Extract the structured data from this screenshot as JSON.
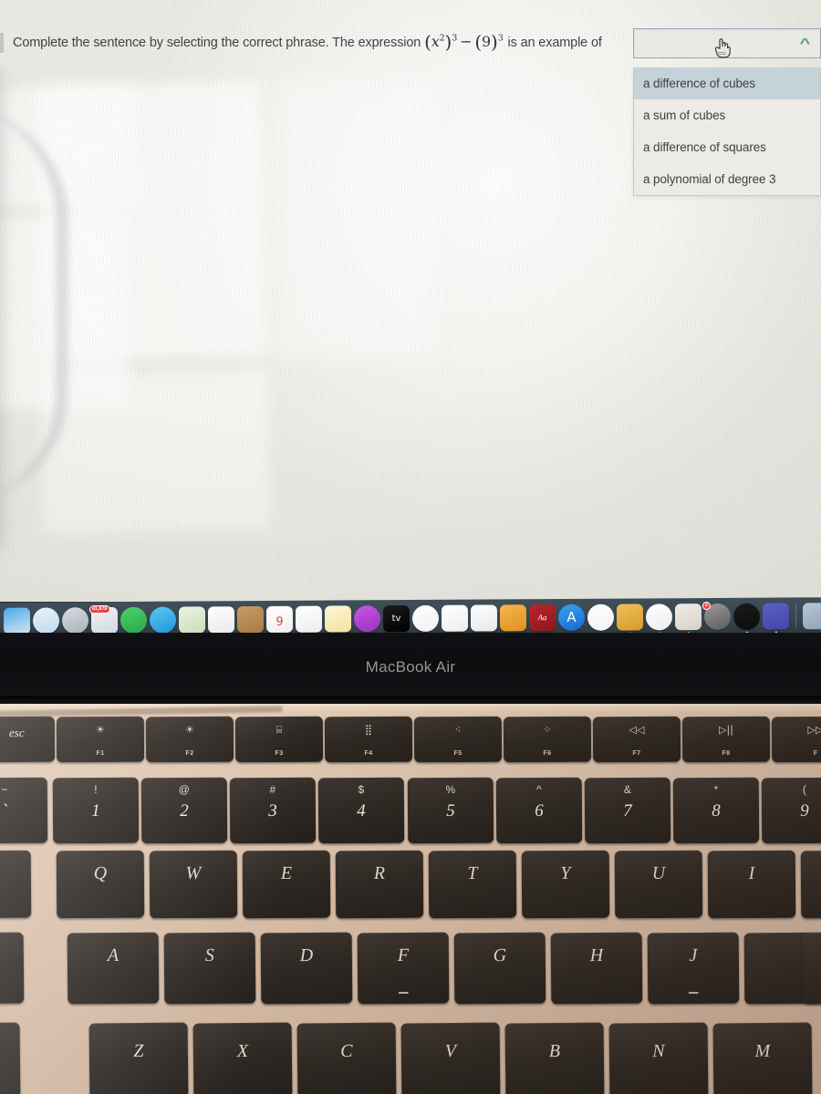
{
  "question": {
    "prefix": "Complete the sentence by selecting the correct phrase. The expression",
    "expr_base": "x",
    "expr_inner_exp": "2",
    "expr_outer_exp": "3",
    "expr_operator": "−",
    "expr_second_base": "9",
    "expr_second_exp": "3",
    "suffix": "is an example of"
  },
  "combo": {
    "value": "",
    "placeholder": "",
    "caret_glyph": "^",
    "caret_color": "#5d9e85",
    "border_color": "#9aa2bc"
  },
  "dropdown": {
    "highlight_color": "#c6d2d9",
    "options": [
      {
        "label": "a difference of cubes",
        "selected": true
      },
      {
        "label": "a sum of cubes",
        "selected": false
      },
      {
        "label": "a difference of squares",
        "selected": false
      },
      {
        "label": "a polynomial of degree 3",
        "selected": false
      }
    ]
  },
  "cursor": {
    "type": "pointing-hand-cursor"
  },
  "dock": {
    "items": [
      {
        "name": "finder",
        "color1": "#4aa8e8",
        "color2": "#d9e6ef",
        "glyph": "",
        "running": true,
        "badge": ""
      },
      {
        "name": "safari",
        "color1": "#e9f3fb",
        "color2": "#bcd9ef",
        "glyph": "",
        "running": false,
        "badge": ""
      },
      {
        "name": "launchpad",
        "color1": "#d8dde1",
        "color2": "#a8b0b6",
        "glyph": "",
        "running": false,
        "badge": ""
      },
      {
        "name": "photos",
        "color1": "#f3f3f3",
        "color2": "#cfd8e2",
        "glyph": "",
        "running": true,
        "badge": "41,878"
      },
      {
        "name": "facetime",
        "color1": "#4cd268",
        "color2": "#2aa84a",
        "glyph": "",
        "running": false,
        "badge": ""
      },
      {
        "name": "messages",
        "color1": "#5ac8f5",
        "color2": "#2196d8",
        "glyph": "",
        "running": false,
        "badge": ""
      },
      {
        "name": "maps",
        "color1": "#eef3e6",
        "color2": "#c9ddb5",
        "glyph": "",
        "running": false,
        "badge": ""
      },
      {
        "name": "photos-rainbow",
        "color1": "#ffffff",
        "color2": "#e9e9e9",
        "glyph": "",
        "running": false,
        "badge": ""
      },
      {
        "name": "contacts",
        "color1": "#c99b63",
        "color2": "#a87a45",
        "glyph": "",
        "running": false,
        "badge": ""
      },
      {
        "name": "calendar",
        "color1": "#ffffff",
        "color2": "#efefef",
        "glyph": "9",
        "running": true,
        "badge": ""
      },
      {
        "name": "reminders",
        "color1": "#ffffff",
        "color2": "#ededed",
        "glyph": "",
        "running": false,
        "badge": ""
      },
      {
        "name": "notes",
        "color1": "#fdf6d8",
        "color2": "#f3e39a",
        "glyph": "",
        "running": false,
        "badge": ""
      },
      {
        "name": "podcasts",
        "color1": "#c65ae0",
        "color2": "#9a2fc4",
        "glyph": "",
        "running": true,
        "badge": ""
      },
      {
        "name": "apple-tv",
        "color1": "#1b1b1b",
        "color2": "#000000",
        "glyph": "tv",
        "running": false,
        "badge": ""
      },
      {
        "name": "news",
        "color1": "#ffffff",
        "color2": "#f0f0f0",
        "glyph": "",
        "running": false,
        "badge": ""
      },
      {
        "name": "numbers",
        "color1": "#ffffff",
        "color2": "#eeeeee",
        "glyph": "",
        "running": true,
        "badge": ""
      },
      {
        "name": "keynote",
        "color1": "#ffffff",
        "color2": "#e7e7e7",
        "glyph": "",
        "running": true,
        "badge": ""
      },
      {
        "name": "pages",
        "color1": "#f7b64a",
        "color2": "#e08f22",
        "glyph": "",
        "running": true,
        "badge": ""
      },
      {
        "name": "dictionary",
        "color1": "#b9252a",
        "color2": "#8c171c",
        "glyph": "Aa",
        "running": false,
        "badge": ""
      },
      {
        "name": "app-store",
        "color1": "#3aa4f0",
        "color2": "#1766cf",
        "glyph": "A",
        "running": false,
        "badge": ""
      },
      {
        "name": "music",
        "color1": "#ffffff",
        "color2": "#f2f2f2",
        "glyph": "",
        "running": true,
        "badge": ""
      },
      {
        "name": "imovie",
        "color1": "#efc15b",
        "color2": "#d79a2a",
        "glyph": "",
        "running": true,
        "badge": ""
      },
      {
        "name": "chrome",
        "color1": "#ffffff",
        "color2": "#ececec",
        "glyph": "",
        "running": true,
        "badge": ""
      },
      {
        "name": "preview",
        "color1": "#f0ede8",
        "color2": "#d6d0c7",
        "glyph": "",
        "running": true,
        "badge": ""
      },
      {
        "name": "system-preferences",
        "color1": "#9a9a9a",
        "color2": "#5c5c5c",
        "glyph": "",
        "running": false,
        "badge": "2"
      },
      {
        "name": "webex",
        "color1": "#1d1d1d",
        "color2": "#0a0a0a",
        "glyph": "",
        "running": true,
        "badge": ""
      },
      {
        "name": "microsoft-teams",
        "color1": "#5b5fc7",
        "color2": "#4347a8",
        "glyph": "",
        "running": true,
        "badge": ""
      },
      {
        "name": "downloads-stack",
        "color1": "#b9c8d6",
        "color2": "#8ea2b4",
        "glyph": "",
        "running": false,
        "badge": ""
      }
    ]
  },
  "laptop": {
    "brand": "MacBook Air"
  },
  "keyboard": {
    "function_row": [
      {
        "key": "esc",
        "glyph": "",
        "sub": "",
        "icon": "escape-key"
      },
      {
        "key": "f1",
        "glyph": "☀",
        "sub": "F1",
        "icon": "brightness-down-icon"
      },
      {
        "key": "f2",
        "glyph": "☀",
        "sub": "F2",
        "icon": "brightness-up-icon"
      },
      {
        "key": "f3",
        "glyph": "⌸",
        "sub": "F3",
        "icon": "mission-control-icon"
      },
      {
        "key": "f4",
        "glyph": "⣿",
        "sub": "F4",
        "icon": "launchpad-icon"
      },
      {
        "key": "f5",
        "glyph": "⁖",
        "sub": "F5",
        "icon": "keyboard-backlight-down-icon"
      },
      {
        "key": "f6",
        "glyph": "⁘",
        "sub": "F6",
        "icon": "keyboard-backlight-up-icon"
      },
      {
        "key": "f7",
        "glyph": "◁◁",
        "sub": "F7",
        "icon": "rewind-icon"
      },
      {
        "key": "f8",
        "glyph": "▷||",
        "sub": "F8",
        "icon": "play-pause-icon"
      },
      {
        "key": "f9",
        "glyph": "▷▷",
        "sub": "F",
        "icon": "fast-forward-icon"
      }
    ],
    "number_row": [
      {
        "shift": "~",
        "digit": "`"
      },
      {
        "shift": "!",
        "digit": "1"
      },
      {
        "shift": "@",
        "digit": "2"
      },
      {
        "shift": "#",
        "digit": "3"
      },
      {
        "shift": "$",
        "digit": "4"
      },
      {
        "shift": "%",
        "digit": "5"
      },
      {
        "shift": "^",
        "digit": "6"
      },
      {
        "shift": "&",
        "digit": "7"
      },
      {
        "shift": "*",
        "digit": "8"
      },
      {
        "shift": "(",
        "digit": "9"
      }
    ],
    "qwerty_row": [
      "",
      "Q",
      "W",
      "E",
      "R",
      "T",
      "Y",
      "U",
      "I"
    ],
    "home_row": [
      "",
      "A",
      "S",
      "D",
      "F",
      "G",
      "H",
      "J",
      ""
    ],
    "bottom_row": [
      "",
      "Z",
      "X",
      "C",
      "V",
      "B",
      "N",
      "M"
    ]
  }
}
